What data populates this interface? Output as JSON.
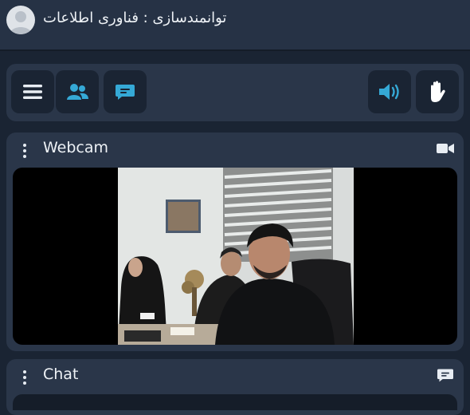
{
  "header": {
    "title": "توانمندسازی : فناوری اطلاعات"
  },
  "toolbar": {
    "buttons": [
      {
        "name": "menu",
        "icon": "hamburger-icon"
      },
      {
        "name": "users",
        "icon": "users-icon"
      },
      {
        "name": "chat",
        "icon": "chat-bubble-icon"
      },
      {
        "name": "audio",
        "icon": "speaker-icon"
      },
      {
        "name": "raise-hand",
        "icon": "hand-icon"
      }
    ]
  },
  "webcam_panel": {
    "title": "Webcam",
    "icon": "video-camera-icon"
  },
  "chat_panel": {
    "title": "Chat",
    "icon": "chat-bubble-icon"
  },
  "colors": {
    "background": "#1a2433",
    "panel": "#2a3649",
    "accent": "#35a9d6"
  }
}
